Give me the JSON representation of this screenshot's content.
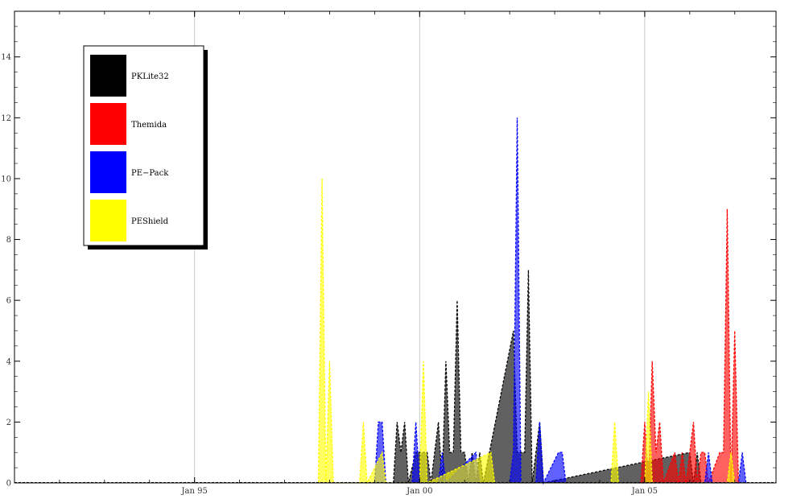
{
  "chart_data": {
    "type": "area",
    "title": "",
    "xlabel": "",
    "ylabel": "",
    "x_tick_labels": [
      "Jan 95",
      "Jan 00",
      "Jan 05"
    ],
    "y_ticks": [
      0,
      2,
      4,
      6,
      8,
      10,
      12,
      14
    ],
    "ylim": [
      0,
      15.5
    ],
    "xlim": [
      "1991-01",
      "2007-12"
    ],
    "grid": "vertical lines at year ticks",
    "legend_placement": "top-left",
    "series": [
      {
        "name": "PKLite32",
        "color": "#000000",
        "points": [
          [
            "1999-06",
            0
          ],
          [
            "1999-07",
            2
          ],
          [
            "1999-08",
            1
          ],
          [
            "1999-09",
            2
          ],
          [
            "1999-10",
            0
          ],
          [
            "1999-12",
            1
          ],
          [
            "2000-01",
            1
          ],
          [
            "2000-02",
            1
          ],
          [
            "2000-03",
            1
          ],
          [
            "2000-04",
            0
          ],
          [
            "2000-06",
            2
          ],
          [
            "2000-07",
            0
          ],
          [
            "2000-08",
            4
          ],
          [
            "2000-09",
            1
          ],
          [
            "2000-10",
            1
          ],
          [
            "2000-11",
            6
          ],
          [
            "2000-12",
            1
          ],
          [
            "2001-01",
            1
          ],
          [
            "2001-02",
            0
          ],
          [
            "2001-03",
            1
          ],
          [
            "2001-04",
            0
          ],
          [
            "2001-05",
            1
          ],
          [
            "2001-06",
            0
          ],
          [
            "2002-02",
            5
          ],
          [
            "2002-03",
            1
          ],
          [
            "2002-04",
            1
          ],
          [
            "2002-05",
            1
          ],
          [
            "2002-06",
            7
          ],
          [
            "2002-07",
            0
          ],
          [
            "2002-09",
            2
          ],
          [
            "2002-10",
            0
          ],
          [
            "2006-01",
            1
          ],
          [
            "2006-02",
            0
          ],
          [
            "2006-03",
            1
          ],
          [
            "2006-04",
            0
          ]
        ]
      },
      {
        "name": "Themida",
        "color": "#ff0000",
        "points": [
          [
            "2004-12",
            0
          ],
          [
            "2005-01",
            2
          ],
          [
            "2005-02",
            0
          ],
          [
            "2005-03",
            4
          ],
          [
            "2005-04",
            1
          ],
          [
            "2005-05",
            2
          ],
          [
            "2005-06",
            0
          ],
          [
            "2005-09",
            1
          ],
          [
            "2005-10",
            0
          ],
          [
            "2005-11",
            1
          ],
          [
            "2005-12",
            0
          ],
          [
            "2006-02",
            2
          ],
          [
            "2006-03",
            0
          ],
          [
            "2006-04",
            1
          ],
          [
            "2006-05",
            1
          ],
          [
            "2006-06",
            0
          ],
          [
            "2006-09",
            1
          ],
          [
            "2006-10",
            1
          ],
          [
            "2006-11",
            9
          ],
          [
            "2006-12",
            0
          ],
          [
            "2007-01",
            5
          ],
          [
            "2007-02",
            0
          ]
        ]
      },
      {
        "name": "PE−Pack",
        "color": "#0000ff",
        "points": [
          [
            "1999-01",
            0
          ],
          [
            "1999-02",
            2
          ],
          [
            "1999-03",
            2
          ],
          [
            "1999-04",
            0
          ],
          [
            "1999-11",
            0
          ],
          [
            "1999-12",
            2
          ],
          [
            "2000-01",
            0
          ],
          [
            "2000-06",
            0
          ],
          [
            "2000-07",
            1
          ],
          [
            "2000-08",
            0
          ],
          [
            "2001-04",
            1
          ],
          [
            "2001-05",
            0
          ],
          [
            "2002-01",
            0
          ],
          [
            "2002-02",
            1
          ],
          [
            "2002-03",
            12
          ],
          [
            "2002-04",
            0
          ],
          [
            "2002-08",
            0
          ],
          [
            "2002-09",
            2
          ],
          [
            "2002-10",
            0
          ],
          [
            "2003-02",
            1
          ],
          [
            "2003-03",
            1
          ],
          [
            "2003-04",
            0
          ],
          [
            "2006-05",
            0
          ],
          [
            "2006-06",
            1
          ],
          [
            "2006-07",
            0
          ],
          [
            "2007-02",
            0
          ],
          [
            "2007-03",
            1
          ],
          [
            "2007-04",
            0
          ]
        ]
      },
      {
        "name": "PEShield",
        "color": "#ffff00",
        "points": [
          [
            "1997-10",
            0
          ],
          [
            "1997-11",
            10
          ],
          [
            "1997-12",
            0
          ],
          [
            "1998-01",
            4
          ],
          [
            "1998-02",
            0
          ],
          [
            "1998-09",
            0
          ],
          [
            "1998-10",
            2
          ],
          [
            "1998-11",
            0
          ],
          [
            "1999-03",
            1
          ],
          [
            "1999-04",
            0
          ],
          [
            "2000-01",
            0
          ],
          [
            "2000-02",
            4
          ],
          [
            "2000-03",
            0
          ],
          [
            "2001-08",
            1
          ],
          [
            "2001-09",
            0
          ],
          [
            "2004-04",
            0
          ],
          [
            "2004-05",
            2
          ],
          [
            "2004-06",
            0
          ],
          [
            "2005-01",
            0
          ],
          [
            "2005-02",
            3
          ],
          [
            "2005-03",
            0
          ],
          [
            "2006-11",
            0
          ],
          [
            "2006-12",
            1
          ],
          [
            "2007-01",
            0
          ]
        ]
      }
    ]
  }
}
